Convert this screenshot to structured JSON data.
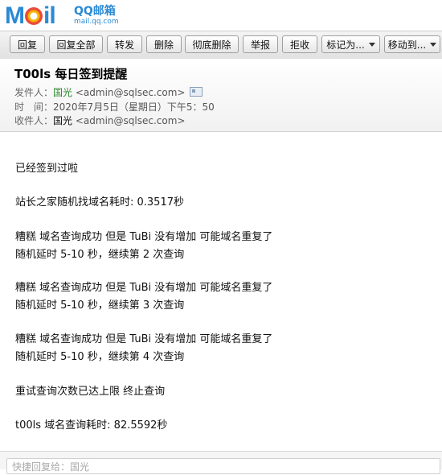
{
  "logo": {
    "brand": "MOil",
    "cn": "QQ邮箱",
    "domain": "mail.qq.com"
  },
  "toolbar": {
    "buttons": [
      "回复",
      "回复全部",
      "转发",
      "删除",
      "彻底删除",
      "举报",
      "拒收",
      "标记为...",
      "移动到..."
    ]
  },
  "header": {
    "subject": "T00ls 每日签到提醒",
    "from_label": "发件人：",
    "from_name": "国光",
    "from_addr": "<admin@sqlsec.com>",
    "time_label": "时　间：",
    "time_value": "2020年7月5日（星期日）下午5：50",
    "to_label": "收件人：",
    "to_name": "国光",
    "to_addr": "<admin@sqlsec.com>"
  },
  "body": {
    "lines": [
      "已经签到过啦",
      "站长之家随机找域名耗时: 0.3517秒",
      "糟糕 域名查询成功 但是 TuBi 没有增加 可能域名重复了",
      "随机延时 5-10 秒，继续第 2 次查询",
      "糟糕 域名查询成功 但是 TuBi 没有增加 可能域名重复了",
      "随机延时 5-10 秒，继续第 3 次查询",
      "糟糕 域名查询成功 但是 TuBi 没有增加 可能域名重复了",
      "随机延时 5-10 秒，继续第 4 次查询",
      "重试查询次数已达上限 终止查询",
      "t00ls 域名查询耗时: 82.5592秒"
    ]
  },
  "reply": {
    "placeholder": "快捷回复给：国光"
  }
}
